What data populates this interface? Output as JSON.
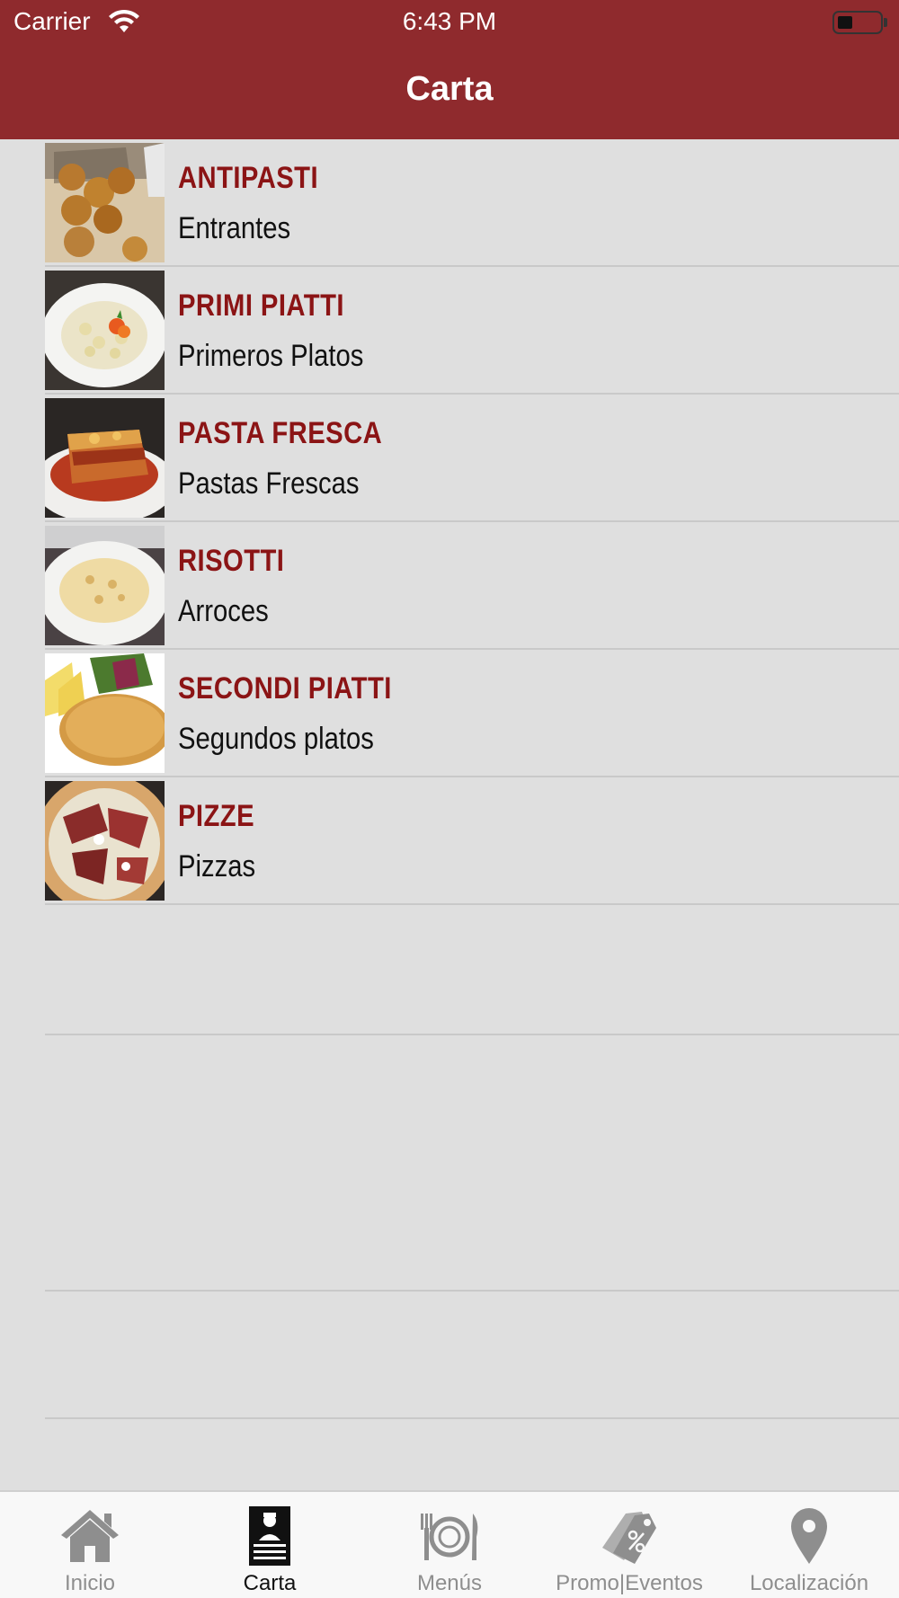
{
  "status_bar": {
    "carrier": "Carrier",
    "time": "6:43 PM"
  },
  "nav": {
    "title": "Carta"
  },
  "categories": [
    {
      "title": "ANTIPASTI",
      "subtitle": "Entrantes",
      "image": "antipasti-photo"
    },
    {
      "title": "PRIMI PIATTI",
      "subtitle": "Primeros Platos",
      "image": "primi-piatti-photo"
    },
    {
      "title": "PASTA FRESCA",
      "subtitle": "Pastas Frescas",
      "image": "pasta-fresca-photo"
    },
    {
      "title": "RISOTTI",
      "subtitle": "Arroces",
      "image": "risotti-photo"
    },
    {
      "title": "SECONDI PIATTI",
      "subtitle": "Segundos platos",
      "image": "secondi-piatti-photo"
    },
    {
      "title": "PIZZE",
      "subtitle": "Pizzas",
      "image": "pizze-photo"
    }
  ],
  "tabs": [
    {
      "label": "Inicio",
      "icon": "home-icon",
      "active": false
    },
    {
      "label": "Carta",
      "icon": "chef-menu-icon",
      "active": true
    },
    {
      "label": "Menús",
      "icon": "plate-cutlery-icon",
      "active": false
    },
    {
      "label": "Promo|Eventos",
      "icon": "discount-tag-icon",
      "active": false
    },
    {
      "label": "Localización",
      "icon": "location-pin-icon",
      "active": false
    }
  ],
  "colors": {
    "header": "#8f2a2d",
    "title_text": "#8b1415",
    "background": "#dfdfdf"
  }
}
